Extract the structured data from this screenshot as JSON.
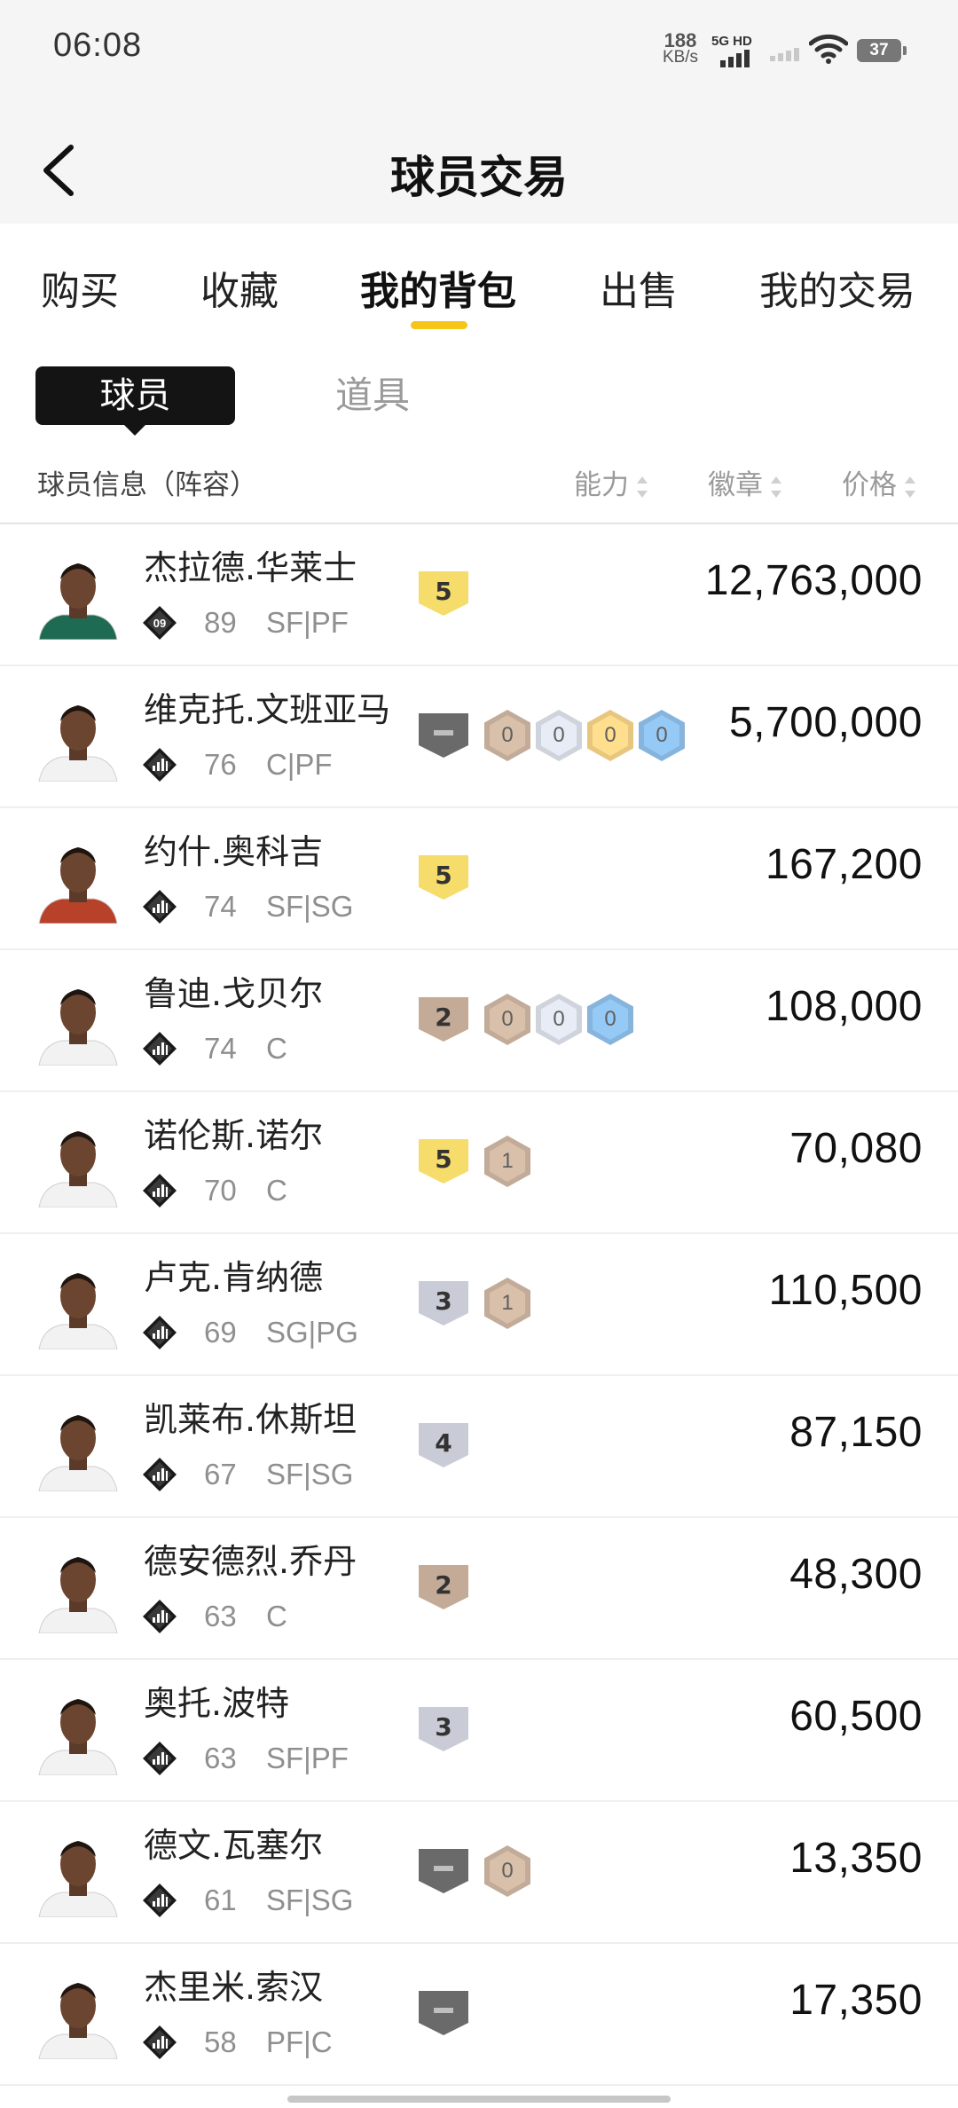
{
  "status_bar": {
    "time": "06:08",
    "net_speed_value": "188",
    "net_speed_unit": "KB/s",
    "network_label": "5G HD",
    "battery": "37"
  },
  "header": {
    "title": "球员交易"
  },
  "tabs": [
    {
      "label": "购买"
    },
    {
      "label": "收藏"
    },
    {
      "label": "我的背包",
      "active": true
    },
    {
      "label": "出售"
    },
    {
      "label": "我的交易"
    }
  ],
  "segment": {
    "players_label": "球员",
    "items_label": "道具"
  },
  "table_header": {
    "info": "球员信息（阵容）",
    "ability": "能力",
    "badges": "徽章",
    "price": "价格"
  },
  "colors": {
    "accent": "#f5c518",
    "gold_card": "#f6dc6a",
    "silver_card": "#c9ccd6",
    "bronze_card": "#c3ab98",
    "dark_card": "#6a6a6a",
    "hex_bronze": "#c2ab98",
    "hex_silver": "#cfd3dc",
    "hex_gold": "#e7c77f",
    "hex_blue": "#86b4dc"
  },
  "players": [
    {
      "name": "杰拉德.华莱士",
      "rating": "89",
      "position": "SF|PF",
      "role_icon": "diamond-09-icon",
      "role_badge_text": "09",
      "jersey": "#1f6a52",
      "card": {
        "tier": "gold",
        "value": "5"
      },
      "badges": [],
      "price": "12,763,000"
    },
    {
      "name": "维克托.文班亚马",
      "rating": "76",
      "position": "C|PF",
      "role_icon": "diamond-bars-icon",
      "jersey": "#f2f2f2",
      "card": {
        "tier": "dark",
        "value": ""
      },
      "badges": [
        {
          "tier": "bronze",
          "count": "0"
        },
        {
          "tier": "silver",
          "count": "0"
        },
        {
          "tier": "gold",
          "count": "0"
        },
        {
          "tier": "blue",
          "count": "0"
        }
      ],
      "price": "5,700,000"
    },
    {
      "name": "约什.奥科吉",
      "rating": "74",
      "position": "SF|SG",
      "role_icon": "diamond-bars-icon",
      "jersey": "#b8412a",
      "card": {
        "tier": "gold",
        "value": "5"
      },
      "badges": [],
      "price": "167,200"
    },
    {
      "name": "鲁迪.戈贝尔",
      "rating": "74",
      "position": "C",
      "role_icon": "diamond-bars-icon",
      "jersey": "#f2f2f2",
      "card": {
        "tier": "bronze",
        "value": "2"
      },
      "badges": [
        {
          "tier": "bronze",
          "count": "0"
        },
        {
          "tier": "silver",
          "count": "0"
        },
        {
          "tier": "blue",
          "count": "0"
        }
      ],
      "price": "108,000"
    },
    {
      "name": "诺伦斯.诺尔",
      "rating": "70",
      "position": "C",
      "role_icon": "diamond-bars-icon",
      "jersey": "#f2f2f2",
      "card": {
        "tier": "gold",
        "value": "5"
      },
      "badges": [
        {
          "tier": "bronze",
          "count": "1"
        }
      ],
      "price": "70,080"
    },
    {
      "name": "卢克.肯纳德",
      "rating": "69",
      "position": "SG|PG",
      "role_icon": "diamond-bars-icon",
      "jersey": "#f2f2f2",
      "card": {
        "tier": "silver",
        "value": "3"
      },
      "badges": [
        {
          "tier": "bronze",
          "count": "1"
        }
      ],
      "price": "110,500"
    },
    {
      "name": "凯莱布.休斯坦",
      "rating": "67",
      "position": "SF|SG",
      "role_icon": "diamond-bars-icon",
      "jersey": "#f2f2f2",
      "card": {
        "tier": "silver",
        "value": "4"
      },
      "badges": [],
      "price": "87,150"
    },
    {
      "name": "德安德烈.乔丹",
      "rating": "63",
      "position": "C",
      "role_icon": "diamond-bars-icon",
      "jersey": "#f2f2f2",
      "card": {
        "tier": "bronze",
        "value": "2"
      },
      "badges": [],
      "price": "48,300"
    },
    {
      "name": "奥托.波特",
      "rating": "63",
      "position": "SF|PF",
      "role_icon": "diamond-bars-icon",
      "jersey": "#f2f2f2",
      "card": {
        "tier": "silver",
        "value": "3"
      },
      "badges": [],
      "price": "60,500"
    },
    {
      "name": "德文.瓦塞尔",
      "rating": "61",
      "position": "SF|SG",
      "role_icon": "diamond-bars-icon",
      "jersey": "#f2f2f2",
      "card": {
        "tier": "dark",
        "value": ""
      },
      "badges": [
        {
          "tier": "bronze",
          "count": "0"
        }
      ],
      "price": "13,350"
    },
    {
      "name": "杰里米.索汉",
      "rating": "58",
      "position": "PF|C",
      "role_icon": "diamond-bars-icon",
      "jersey": "#f2f2f2",
      "card": {
        "tier": "dark",
        "value": ""
      },
      "badges": [],
      "price": "17,350"
    }
  ]
}
